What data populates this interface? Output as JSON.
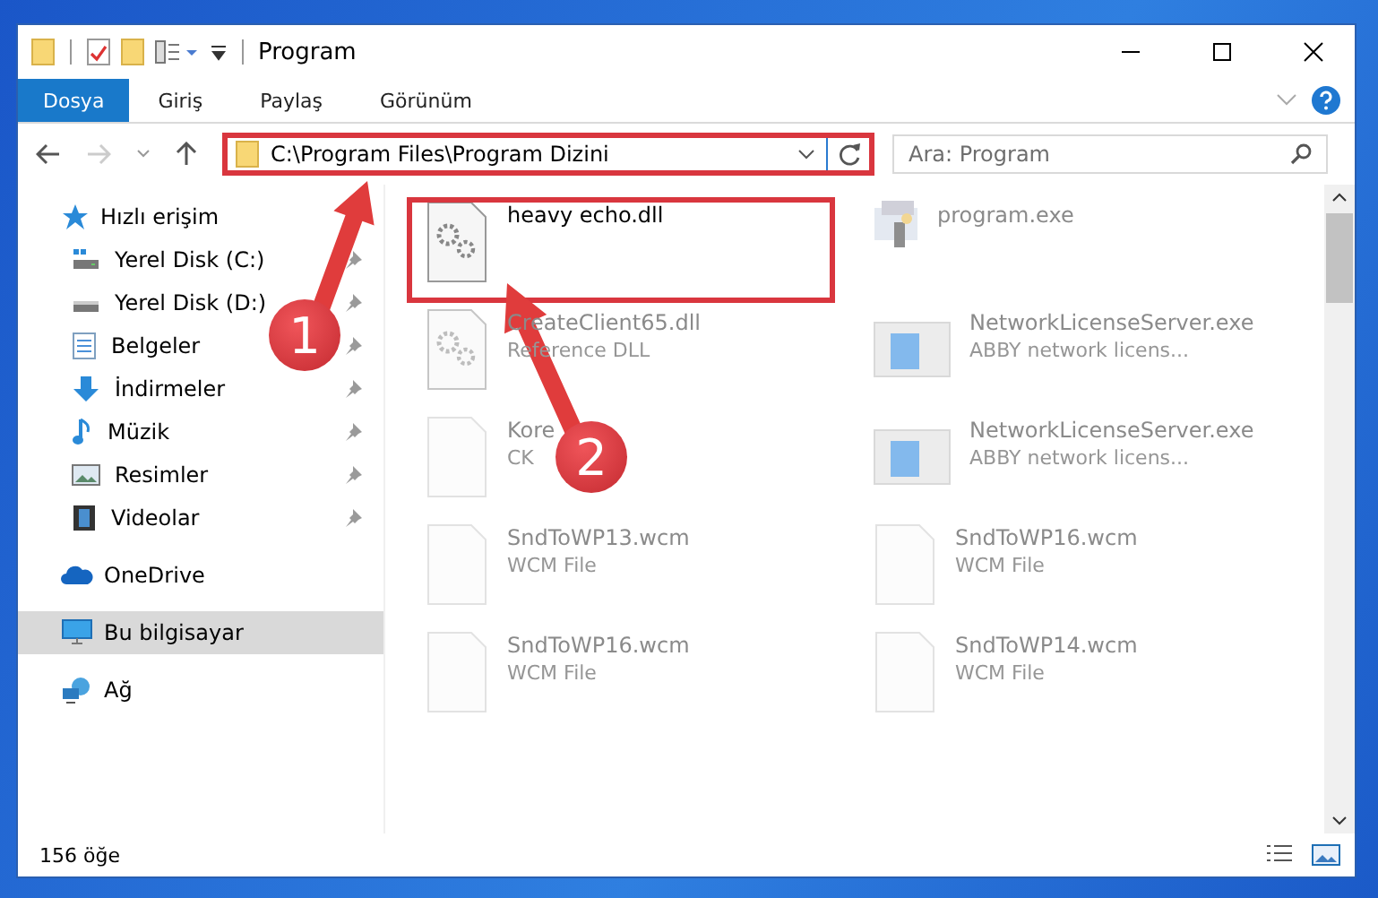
{
  "window": {
    "title": "Program"
  },
  "ribbon_tabs": [
    {
      "label": "Dosya",
      "selected": true
    },
    {
      "label": "Giriş",
      "selected": false
    },
    {
      "label": "Paylaş",
      "selected": false
    },
    {
      "label": "Görünüm",
      "selected": false
    }
  ],
  "address": {
    "path": "C:\\Program Files\\Program Dizini"
  },
  "search": {
    "placeholder": "Ara: Program"
  },
  "sidebar": {
    "items": [
      {
        "label": "Hızlı erişim",
        "kind": "star",
        "selected": false,
        "children": [
          {
            "label": "Yerel Disk (C:)",
            "kind": "drive-c",
            "selected": false
          },
          {
            "label": "Yerel Disk (D:)",
            "kind": "drive",
            "selected": false
          },
          {
            "label": "Belgeler",
            "kind": "document",
            "selected": false
          },
          {
            "label": "İndirmeler",
            "kind": "download",
            "selected": false
          },
          {
            "label": "Müzik",
            "kind": "music",
            "selected": false
          },
          {
            "label": "Resimler",
            "kind": "pictures",
            "selected": false
          },
          {
            "label": "Videolar",
            "kind": "video",
            "selected": false
          }
        ]
      },
      {
        "label": "OneDrive",
        "kind": "cloud",
        "selected": false
      },
      {
        "label": "Bu bilgisayar",
        "kind": "computer",
        "selected": true
      },
      {
        "label": "Ağ",
        "kind": "network",
        "selected": false
      }
    ]
  },
  "files": [
    {
      "name": "heavy echo.dll",
      "kind": "gear",
      "faded": false
    },
    {
      "name": "program.exe",
      "kind": "app",
      "faded": true
    },
    {
      "name": "CreateClient65.dll",
      "type": "Reference DLL",
      "kind": "gear",
      "faded": true
    },
    {
      "name": "NetworkLicenseServer.exe",
      "type": "ABBY network licens...",
      "kind": "window",
      "faded": true
    },
    {
      "name": "Kore",
      "type": "CK",
      "kind": "blank",
      "faded": true
    },
    {
      "name": "NetworkLicenseServer.exe",
      "type": "ABBY network licens...",
      "kind": "window",
      "faded": true
    },
    {
      "name": "SndToWP13.wcm",
      "type": "WCM File",
      "kind": "blank",
      "faded": true
    },
    {
      "name": "SndToWP16.wcm",
      "type": "WCM File",
      "kind": "blank",
      "faded": true
    },
    {
      "name": "SndToWP16.wcm",
      "type": "WCM File",
      "kind": "blank",
      "faded": true
    },
    {
      "name": "SndToWP14.wcm",
      "type": "WCM File",
      "kind": "blank",
      "faded": true
    }
  ],
  "status_bar": {
    "count": "156 öğe"
  },
  "annotations": [
    {
      "number": "1"
    },
    {
      "number": "2"
    }
  ]
}
